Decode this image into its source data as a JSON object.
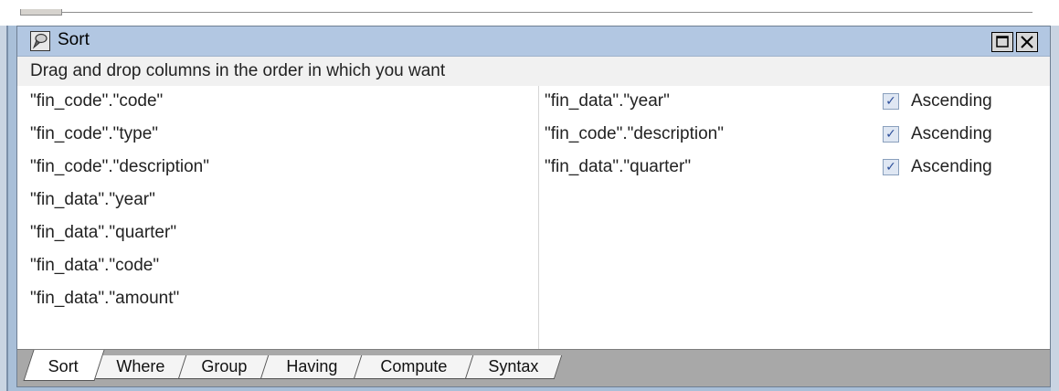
{
  "window": {
    "title": "Sort",
    "instruction": "Drag and drop columns in the order in which you want"
  },
  "available_columns": [
    "\"fin_code\".\"code\"",
    "\"fin_code\".\"type\"",
    "\"fin_code\".\"description\"",
    "\"fin_data\".\"year\"",
    "\"fin_data\".\"quarter\"",
    "\"fin_data\".\"code\"",
    "\"fin_data\".\"amount\""
  ],
  "sort_columns": [
    {
      "name": "\"fin_data\".\"year\"",
      "checked": true,
      "label": "Ascending"
    },
    {
      "name": "\"fin_code\".\"description\"",
      "checked": true,
      "label": "Ascending"
    },
    {
      "name": "\"fin_data\".\"quarter\"",
      "checked": true,
      "label": "Ascending"
    }
  ],
  "tabs": [
    "Sort",
    "Where",
    "Group",
    "Having",
    "Compute",
    "Syntax"
  ],
  "active_tab": "Sort",
  "icons": {
    "title": "sort-window-icon",
    "maximize": "maximize-icon",
    "close": "close-icon",
    "check": "checkmark-icon"
  },
  "colors": {
    "titlebar": "#b2c7e2",
    "instruction_bg": "#f1f1f1",
    "tabbar": "#a8a8a8",
    "check": "#2d4f9a"
  }
}
